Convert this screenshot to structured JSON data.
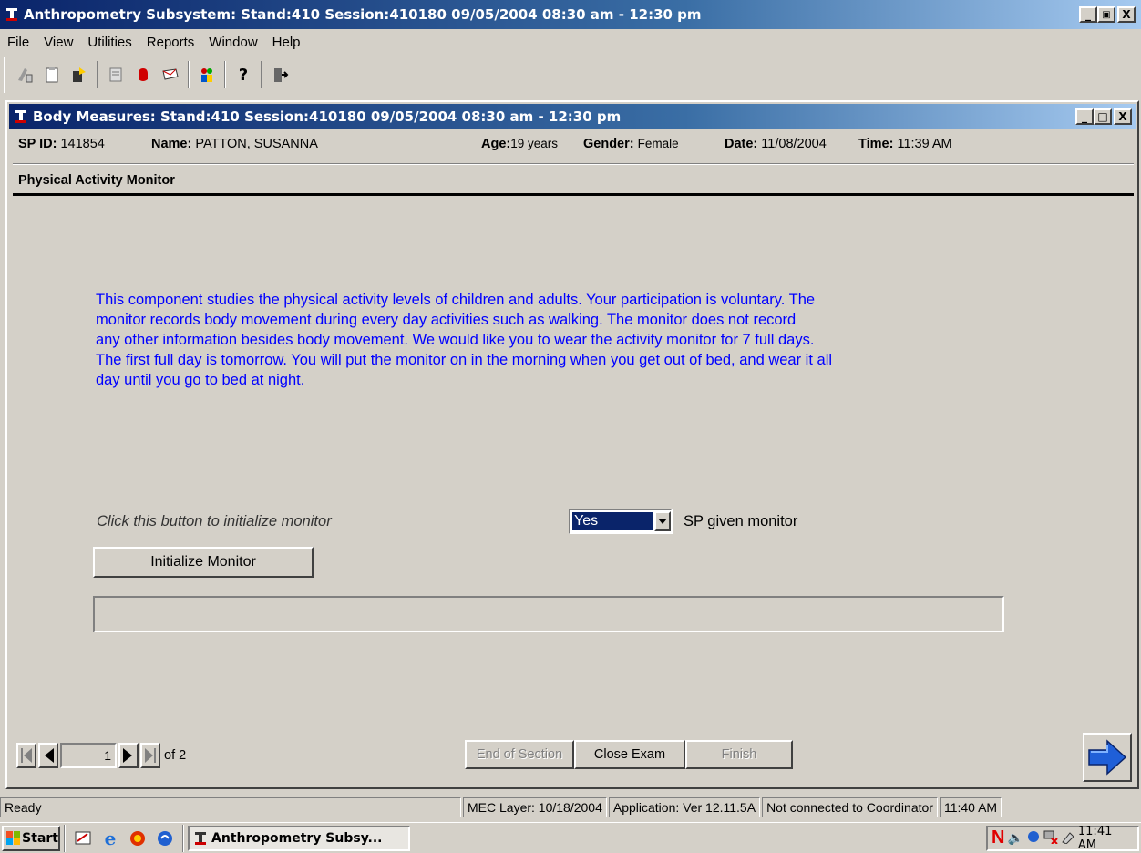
{
  "app": {
    "title": "Anthropometry Subsystem: Stand:410 Session:410180 09/05/2004 08:30 am - 12:30 pm",
    "window_buttons": [
      "_",
      "🗗",
      "X"
    ]
  },
  "menu": [
    "File",
    "View",
    "Utilities",
    "Reports",
    "Window",
    "Help"
  ],
  "toolbar": {
    "icons": [
      "clear-icon",
      "clipboard-icon",
      "export-icon",
      "notes-icon",
      "stop-hand-icon",
      "mail-icon",
      "people-icon",
      "help-icon",
      "exit-door-icon"
    ]
  },
  "child": {
    "title": "Body Measures: Stand:410 Session:410180 09/05/2004 08:30 am - 12:30 pm",
    "window_buttons": [
      "_",
      "□",
      "X"
    ]
  },
  "header": {
    "sp_id_label": "SP ID:",
    "sp_id": "141854",
    "name_label": "Name:",
    "name": "PATTON, SUSANNA",
    "age_label": "Age:",
    "age": "19 years",
    "gender_label": "Gender:",
    "gender": "Female",
    "date_label": "Date:",
    "date": "11/08/2004",
    "time_label": "Time:",
    "time": "11:39 AM"
  },
  "section_title": "Physical Activity Monitor",
  "info_text": [
    "This component studies the physical activity levels of children and adults. Your participation is voluntary. The",
    "monitor records body movement during every day activities such as walking. The monitor does not record",
    "any other information besides body movement. We would like you to wear the activity monitor for 7 full days.",
    "The first full day is tomorrow. You will put the monitor on in the morning when you get out of bed, and wear it all",
    "day until you go to bed at night."
  ],
  "initialize": {
    "prompt": "Click this button to initialize monitor",
    "button": "Initialize Monitor",
    "progress": ""
  },
  "given": {
    "selected": "Yes",
    "label": "SP given monitor"
  },
  "pager": {
    "page": "1",
    "of": "of 2"
  },
  "bottom_buttons": {
    "end_section": "End of Section",
    "close_exam": "Close Exam",
    "finish": "Finish"
  },
  "statusbar": {
    "ready": "Ready",
    "mec_layer": "MEC Layer: 10/18/2004",
    "application": "Application: Ver 12.11.5A",
    "coordinator": "Not connected to Coordinator",
    "time": "11:40 AM"
  },
  "taskbar": {
    "start": "Start",
    "task": "Anthropometry Subsy...",
    "clock": "11:41 AM"
  },
  "colors": {
    "title_start": "#0a246a",
    "title_end": "#a6caf0",
    "info_text": "#0000ff",
    "select_highlight": "#0a246a",
    "next_arrow": "#1f5fd8"
  }
}
